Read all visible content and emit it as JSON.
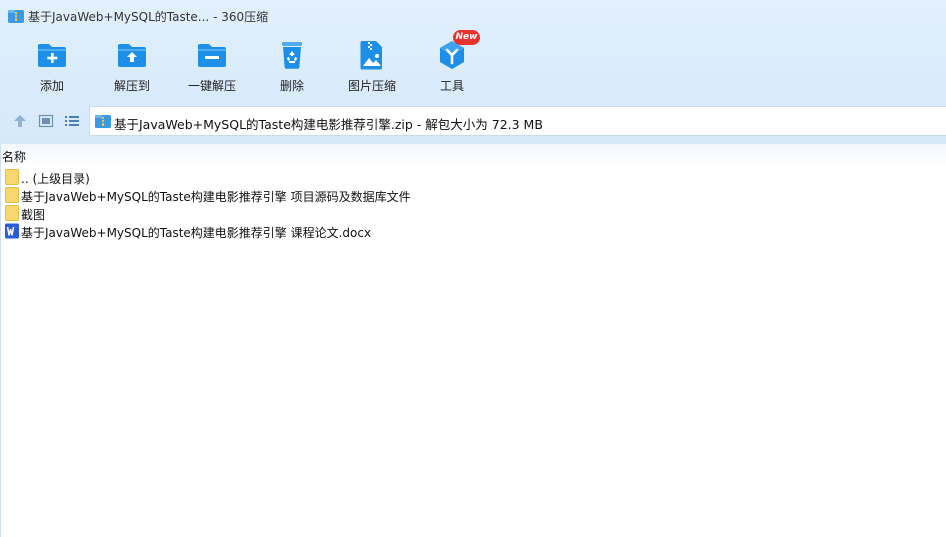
{
  "window": {
    "title": "基于JavaWeb+MySQL的Taste... - 360压缩",
    "app_icon": "archive-icon"
  },
  "toolbar": {
    "items": [
      {
        "label": "添加",
        "icon": "add-folder-icon"
      },
      {
        "label": "解压到",
        "icon": "extract-to-folder-icon"
      },
      {
        "label": "一键解压",
        "icon": "one-click-extract-icon"
      },
      {
        "label": "删除",
        "icon": "recycle-bin-icon"
      },
      {
        "label": "图片压缩",
        "icon": "image-compress-icon"
      },
      {
        "label": "工具",
        "icon": "tools-cube-icon",
        "badge": "New"
      }
    ]
  },
  "navbar": {
    "address": "基于JavaWeb+MySQL的Taste构建电影推荐引擎.zip - 解包大小为 72.3 MB"
  },
  "list": {
    "column_name": "名称",
    "rows": [
      {
        "name": ".. (上级目录)",
        "type": "folder"
      },
      {
        "name": "基于JavaWeb+MySQL的Taste构建电影推荐引擎 项目源码及数据库文件",
        "type": "folder"
      },
      {
        "name": "截图",
        "type": "folder"
      },
      {
        "name": "基于JavaWeb+MySQL的Taste构建电影推荐引擎 课程论文.docx",
        "type": "word"
      }
    ]
  },
  "colors": {
    "accent": "#1e8fe8",
    "toolbar_bg": "#dcedfc",
    "folder": "#f7d86e",
    "word": "#2b5bd6",
    "badge": "#e8322d"
  }
}
